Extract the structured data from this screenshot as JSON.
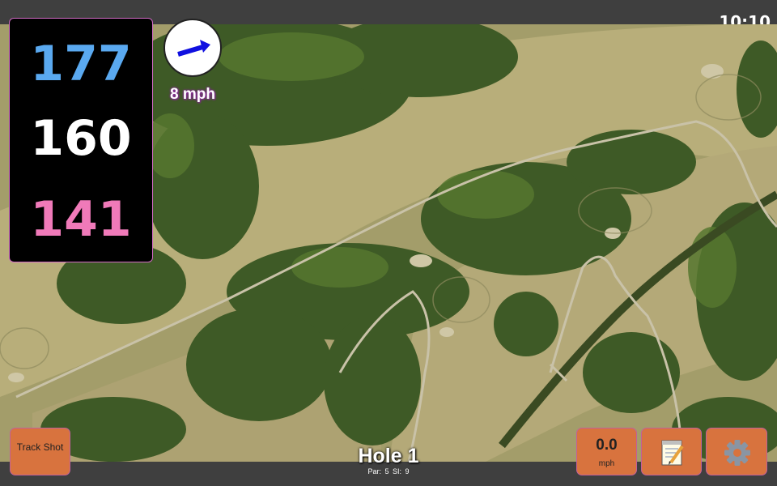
{
  "status": {
    "time": "10:10"
  },
  "yardage": {
    "back": "177",
    "middle": "160",
    "front": "141"
  },
  "wind": {
    "speed_label": "8 mph"
  },
  "buttons": {
    "track_shot": "Track Shot",
    "speed_value": "0.0",
    "speed_unit": "mph",
    "notes_icon": "notepad-icon",
    "settings_icon": "gear-icon"
  },
  "hole": {
    "title": "Hole 1",
    "par": "Par: 5",
    "si": "SI: 9"
  },
  "colors": {
    "back": "#5aa9f0",
    "middle": "#ffffff",
    "front": "#f07ab9",
    "button": "#d8733e",
    "wind_arrow": "#1010e0"
  }
}
